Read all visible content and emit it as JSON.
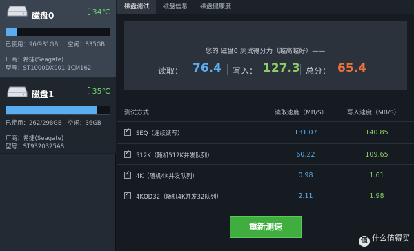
{
  "sidebar": {
    "disks": [
      {
        "name": "磁盘0",
        "temperature": "34℃",
        "usage_fraction": 0.103,
        "used": "已使用：96/931GB",
        "free": "空闲：835GB",
        "maker": "厂商：希捷(Seagate)",
        "model": "型号：ST1000DX001-1CM162"
      },
      {
        "name": "磁盘1",
        "temperature": "35℃",
        "usage_fraction": 0.879,
        "used": "已使用：262/298GB",
        "free": "空闲：36GB",
        "maker": "厂商：希捷(Seagate)",
        "model": "型号：ST9320325AS"
      }
    ]
  },
  "tabs": [
    {
      "label": "磁盘测试",
      "active": true
    },
    {
      "label": "磁盘信息",
      "active": false
    },
    {
      "label": "磁盘健康度",
      "active": false
    }
  ],
  "score": {
    "title": "您的 磁盘0 测试得分为（越高越好）——",
    "read_label": "读取：",
    "read_value": "76.4",
    "write_label": "写入：",
    "write_value": "127.3",
    "total_label": "总分：",
    "total_value": "65.4"
  },
  "table": {
    "headers": {
      "method": "测试方式",
      "read": "读取速度（MB/S）",
      "write": "写入速度（MB/S）"
    },
    "rows": [
      {
        "name": "SEQ（连续读写）",
        "read": "131.07",
        "write": "140.85",
        "checked": true
      },
      {
        "name": "512K（随机512K并发队列）",
        "read": "60.22",
        "write": "109.65",
        "checked": true
      },
      {
        "name": "4K（随机4K并发队列）",
        "read": "0.98",
        "write": "1.61",
        "checked": true
      },
      {
        "name": "4KQD32（随机4K并发32队列）",
        "read": "2.11",
        "write": "1.98",
        "checked": true
      }
    ]
  },
  "buttons": {
    "retest": "重新测速"
  },
  "watermark": {
    "badge": "值",
    "text": "什么值得买"
  },
  "colors": {
    "read": "#5aaef0",
    "write": "#8bd063",
    "total": "#f0703c",
    "temperature": "#6fd16f",
    "accent_green": "#3fae3f"
  }
}
